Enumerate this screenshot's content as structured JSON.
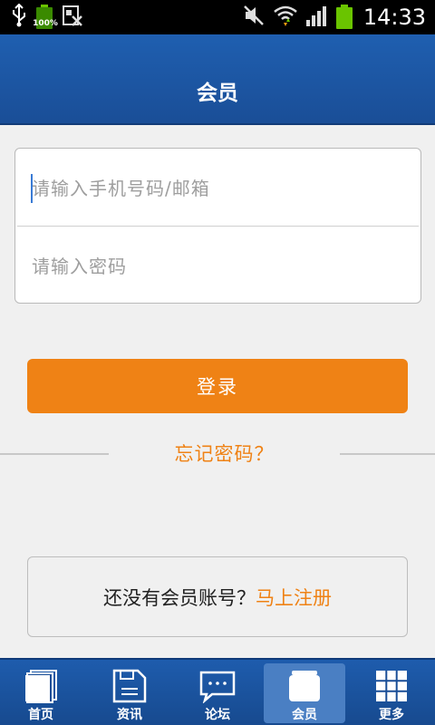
{
  "status_bar": {
    "time": "14:33",
    "battery_small_pct": "100%",
    "icons": [
      "usb-icon",
      "battery-icon",
      "photo-icon",
      "mute-icon",
      "wifi-icon",
      "signal-icon",
      "battery-icon"
    ]
  },
  "header": {
    "title": "会员"
  },
  "login_form": {
    "account_placeholder": "请输入手机号码/邮箱",
    "password_placeholder": "请输入密码"
  },
  "login_button": "登录",
  "forgot_password": "忘记密码？",
  "register": {
    "prompt": "还没有会员账号？",
    "link": "马上注册"
  },
  "bottom_nav": {
    "items": [
      {
        "label": "首页",
        "icon": "home-pages-icon"
      },
      {
        "label": "资讯",
        "icon": "news-file-icon"
      },
      {
        "label": "论坛",
        "icon": "forum-chat-icon"
      },
      {
        "label": "会员",
        "icon": "member-card-icon",
        "active": true
      },
      {
        "label": "更多",
        "icon": "more-grid-icon"
      }
    ]
  },
  "colors": {
    "header_blue": "#1f5fb0",
    "accent_orange": "#ef8215",
    "status_bar": "#000000",
    "battery_green": "#6ac400"
  }
}
